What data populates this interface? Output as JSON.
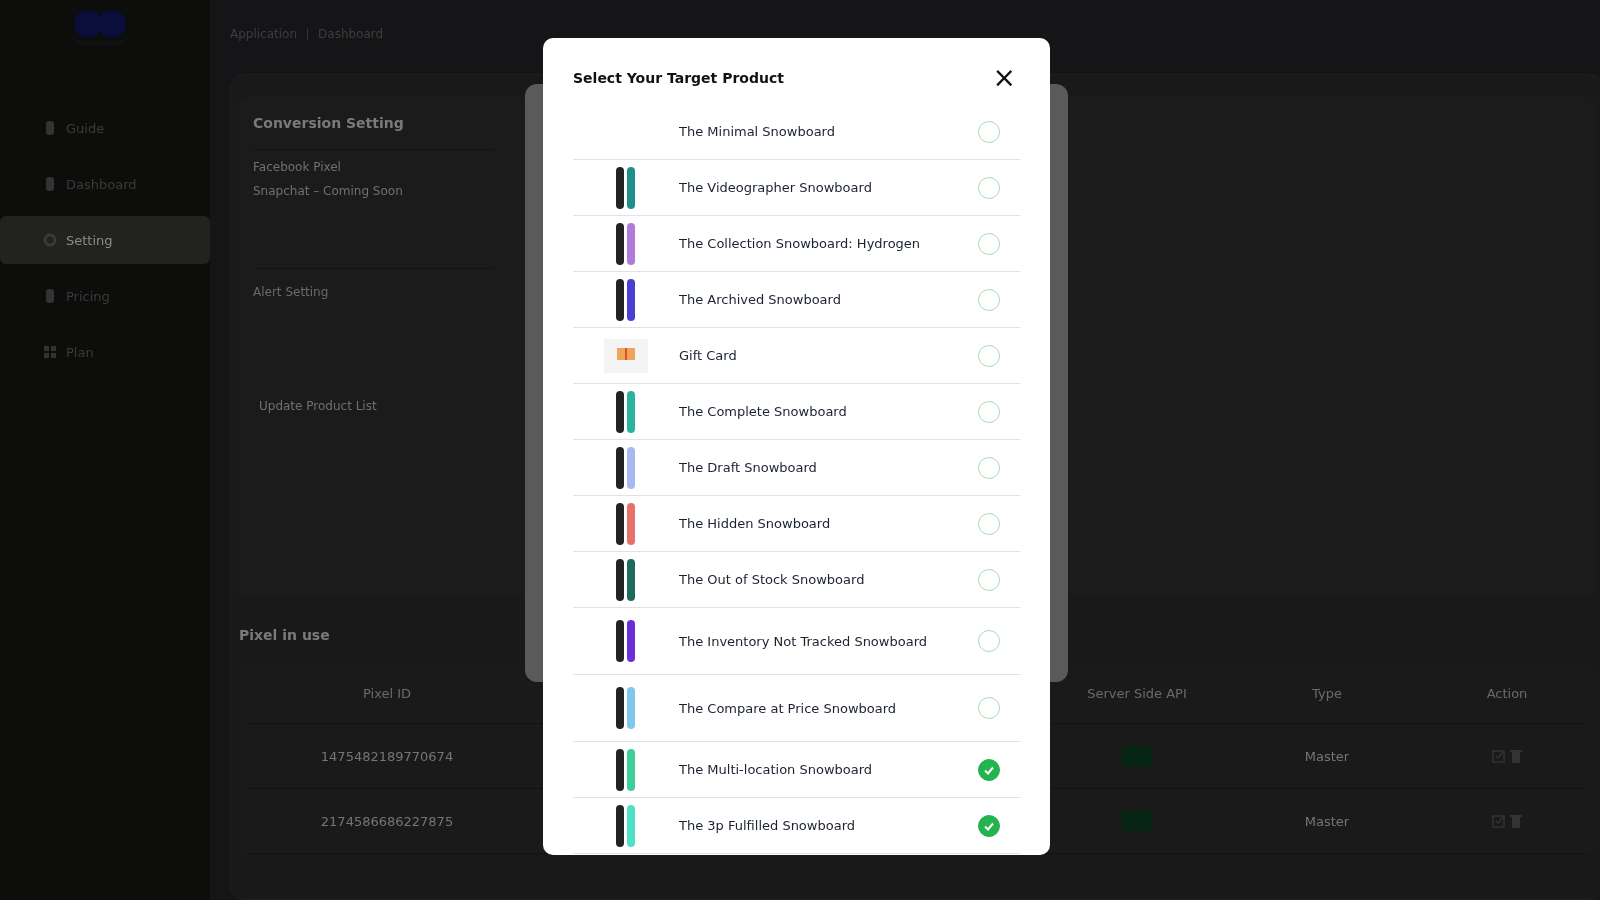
{
  "sidebar": {
    "items": [
      {
        "label": "Guide",
        "selected": false
      },
      {
        "label": "Dashboard",
        "selected": false
      },
      {
        "label": "Setting",
        "selected": true
      },
      {
        "label": "Pricing",
        "selected": false
      },
      {
        "label": "Plan",
        "selected": false
      }
    ]
  },
  "breadcrumb": [
    "Application",
    "Dashboard"
  ],
  "conversion_setting": {
    "title": "Conversion Setting",
    "items": [
      "Facebook Pixel",
      "Snapchat – Coming Soon"
    ],
    "alert": "Alert Setting",
    "update_button": "Update Product List"
  },
  "pixel_table": {
    "title": "Pixel in use",
    "columns": [
      "Pixel ID",
      "Server Side API",
      "Type",
      "Action"
    ],
    "rows": [
      {
        "pixel_id": "1475482189770674",
        "type": "Master"
      },
      {
        "pixel_id": "2174586686227875",
        "type": "Master"
      }
    ]
  },
  "modal": {
    "title": "Select Your Target Product",
    "close": "×",
    "products": [
      {
        "name": "The Minimal Snowboard",
        "kind": "none",
        "selected": false
      },
      {
        "name": "The Videographer Snowboard",
        "kind": "snowboard",
        "color": "#1f8f8a",
        "selected": false
      },
      {
        "name": "The Collection Snowboard: Hydrogen",
        "kind": "snowboard",
        "color": "#b07ad8",
        "selected": false
      },
      {
        "name": "The Archived Snowboard",
        "kind": "snowboard",
        "color": "#4b3fd0",
        "selected": false
      },
      {
        "name": "Gift Card",
        "kind": "gift-card",
        "selected": false
      },
      {
        "name": "The Complete Snowboard",
        "kind": "snowboard",
        "color": "#2bb3a0",
        "selected": false
      },
      {
        "name": "The Draft Snowboard",
        "kind": "snowboard",
        "color": "#a9b8f0",
        "selected": false
      },
      {
        "name": "The Hidden Snowboard",
        "kind": "snowboard",
        "color": "#e8706a",
        "selected": false
      },
      {
        "name": "The Out of Stock Snowboard",
        "kind": "snowboard",
        "color": "#1e6b5c",
        "selected": false
      },
      {
        "name": "The Inventory Not Tracked Snowboard",
        "kind": "snowboard",
        "color": "#6a2fd8",
        "selected": false
      },
      {
        "name": "The Compare at Price Snowboard",
        "kind": "snowboard",
        "color": "#7fc8ea",
        "selected": false
      },
      {
        "name": "The Multi-location Snowboard",
        "kind": "snowboard",
        "color": "#3ccf9a",
        "selected": true
      },
      {
        "name": "The 3p Fulfilled Snowboard",
        "kind": "snowboard",
        "color": "#4fe0c8",
        "selected": true
      }
    ]
  }
}
